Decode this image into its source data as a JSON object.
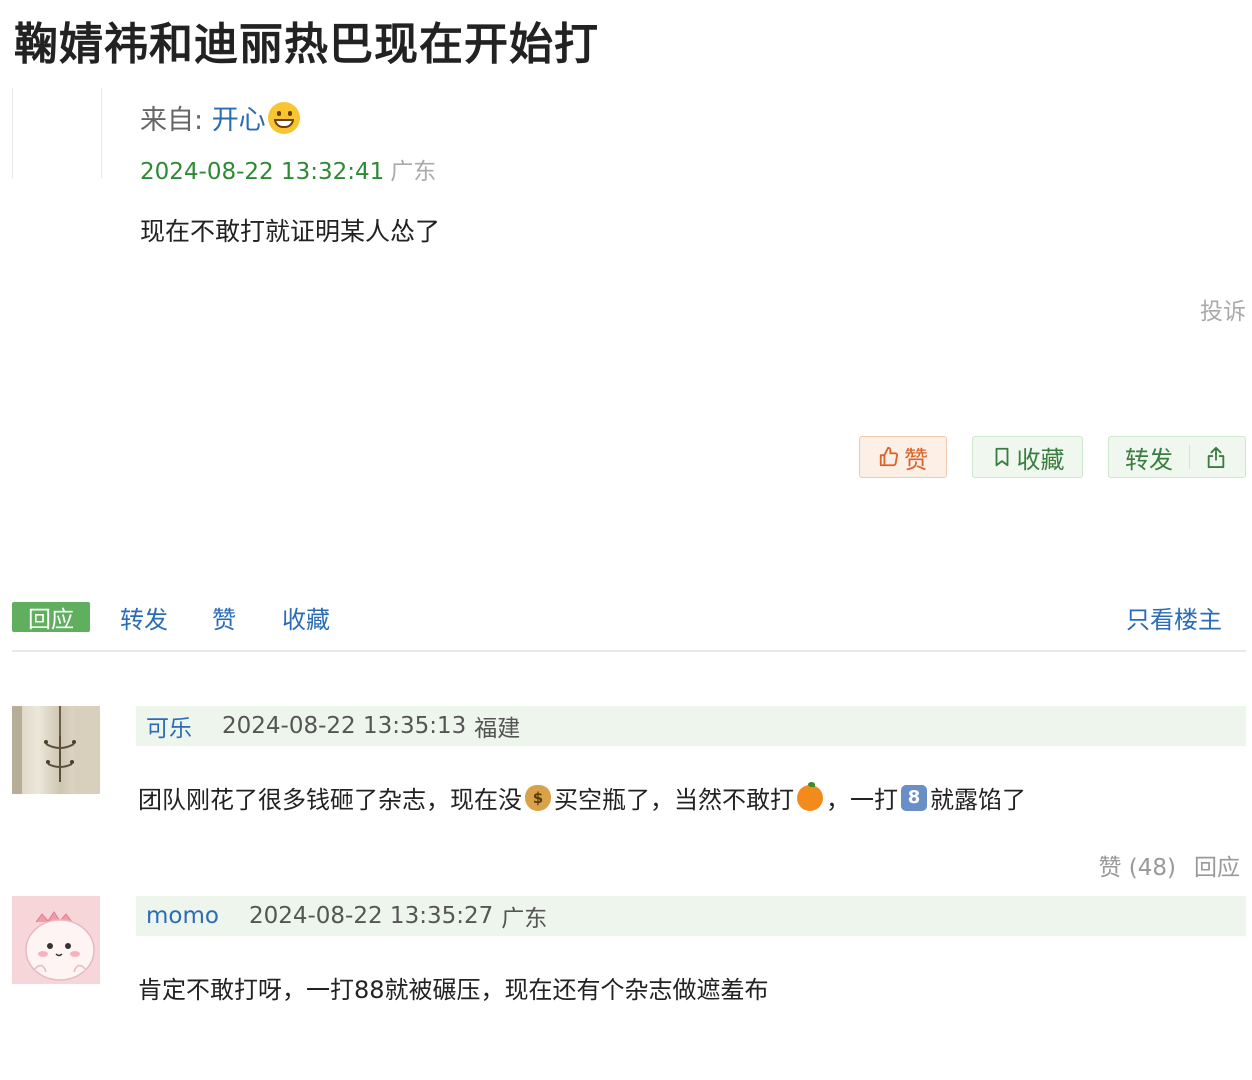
{
  "post": {
    "title": "鞠婧祎和迪丽热巴现在开始打",
    "from_label": "来自: ",
    "author": "开心",
    "author_emoji": "grinning-face-icon",
    "timestamp": "2024-08-22 13:32:41",
    "location": "广东",
    "content": "现在不敢打就证明某人怂了",
    "report_label": "投诉",
    "buttons": {
      "like": "赞",
      "favorite": "收藏",
      "forward": "转发"
    }
  },
  "action_bar": {
    "reply": "回应",
    "forward": "转发",
    "like": "赞",
    "favorite": "收藏",
    "only_op": "只看楼主"
  },
  "comments": [
    {
      "author": "可乐",
      "timestamp": "2024-08-22 13:35:13",
      "location": "福建",
      "content_parts": [
        "团队刚花了很多钱砸了杂志，现在没",
        "买空瓶了，当然不敢打",
        "，一打",
        "就露馅了"
      ],
      "emojis": [
        "money-bag-icon",
        "orange-icon",
        "keycap-8-icon"
      ],
      "likes_label": "赞 (48)",
      "reply_label": "回应"
    },
    {
      "author": "momo",
      "timestamp": "2024-08-22 13:35:27",
      "location": "广东",
      "content": "肯定不敢打呀，一打88就被碾压，现在还有个杂志做遮羞布"
    }
  ],
  "colors": {
    "link_blue": "#2a6db5",
    "time_green": "#2d8a34",
    "reply_button_green": "#5faf5f",
    "comment_header_bg": "#eef5ec",
    "like_orange": "#d9642a"
  }
}
